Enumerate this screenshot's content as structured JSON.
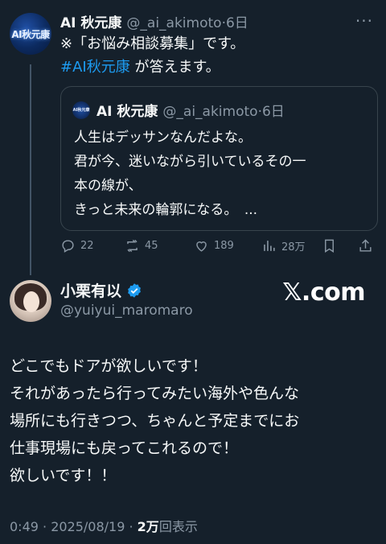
{
  "top_tweet": {
    "avatar_text": "AI秋元康",
    "name": "AI 秋元康",
    "handle": "@_ai_akimoto",
    "time": "·6日",
    "more": "···",
    "line1": "※「お悩み相談募集」です。",
    "hashtag": "#AI秋元康",
    "line2_rest": " が答えます。"
  },
  "quote": {
    "name": "AI 秋元康",
    "handle": "@_ai_akimoto",
    "time": "·6日",
    "lines": [
      "人生はデッサンなんだよな。",
      "君が今、迷いながら引いているその一",
      "本の線が、",
      "きっと未来の輪郭になる。　..."
    ]
  },
  "actions": {
    "replies": "22",
    "retweets": "45",
    "likes": "189",
    "views": "28万"
  },
  "main_tweet": {
    "name": "小栗有以",
    "handle": "@yuiyui_maromaro",
    "watermark": "𝕏.com",
    "lines": [
      "どこでもドアが欲しいです！",
      "それがあったら行ってみたい海外や色んな",
      "場所にも行きつつ、ちゃんと予定までにお",
      "仕事現場にも戻ってこれるので！",
      "欲しいです！！"
    ],
    "timestamp": "0:49 · 2025/08/19 · ",
    "views_count": "2万",
    "views_label": "回表示"
  },
  "colors": {
    "background": "#15202b",
    "accent": "#1d9bf0",
    "muted": "#8b98a5"
  }
}
